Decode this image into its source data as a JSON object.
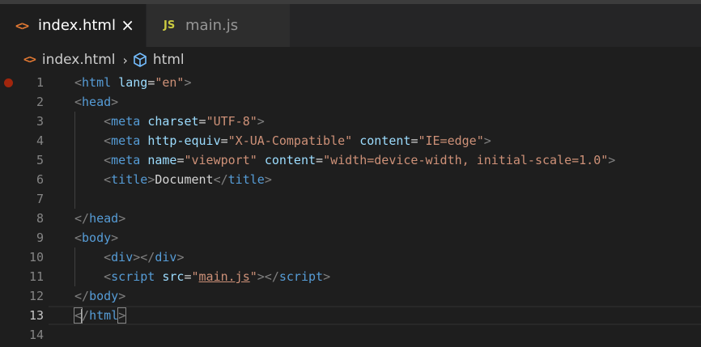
{
  "tabs": [
    {
      "label": "index.html",
      "icon": "html-file-icon",
      "active": true
    },
    {
      "label": "main.js",
      "icon": "js-file-icon",
      "active": false
    }
  ],
  "tab_close": "×",
  "html_glyph": "<>",
  "js_glyph": "JS",
  "breadcrumb": {
    "file": "index.html",
    "symbol": "html",
    "separator": "›"
  },
  "editor": {
    "current_line": 13,
    "lines": [
      {
        "n": "1",
        "tokens": [
          [
            "punc",
            "<"
          ],
          [
            "tag",
            "html"
          ],
          [
            "text",
            " "
          ],
          [
            "attr",
            "lang"
          ],
          [
            "eq",
            "="
          ],
          [
            "str",
            "\"en\""
          ],
          [
            "punc",
            ">"
          ]
        ]
      },
      {
        "n": "2",
        "tokens": [
          [
            "punc",
            "<"
          ],
          [
            "tag",
            "head"
          ],
          [
            "punc",
            ">"
          ]
        ]
      },
      {
        "n": "3",
        "tokens": [
          [
            "text",
            "    "
          ],
          [
            "punc",
            "<"
          ],
          [
            "tag",
            "meta"
          ],
          [
            "text",
            " "
          ],
          [
            "attr",
            "charset"
          ],
          [
            "eq",
            "="
          ],
          [
            "str",
            "\"UTF-8\""
          ],
          [
            "punc",
            ">"
          ]
        ]
      },
      {
        "n": "4",
        "tokens": [
          [
            "text",
            "    "
          ],
          [
            "punc",
            "<"
          ],
          [
            "tag",
            "meta"
          ],
          [
            "text",
            " "
          ],
          [
            "attr",
            "http-equiv"
          ],
          [
            "eq",
            "="
          ],
          [
            "str",
            "\"X-UA-Compatible\""
          ],
          [
            "text",
            " "
          ],
          [
            "attr",
            "content"
          ],
          [
            "eq",
            "="
          ],
          [
            "str",
            "\"IE=edge\""
          ],
          [
            "punc",
            ">"
          ]
        ]
      },
      {
        "n": "5",
        "tokens": [
          [
            "text",
            "    "
          ],
          [
            "punc",
            "<"
          ],
          [
            "tag",
            "meta"
          ],
          [
            "text",
            " "
          ],
          [
            "attr",
            "name"
          ],
          [
            "eq",
            "="
          ],
          [
            "str",
            "\"viewport\""
          ],
          [
            "text",
            " "
          ],
          [
            "attr",
            "content"
          ],
          [
            "eq",
            "="
          ],
          [
            "str",
            "\"width=device-width, initial-scale=1.0\""
          ],
          [
            "punc",
            ">"
          ]
        ]
      },
      {
        "n": "6",
        "tokens": [
          [
            "text",
            "    "
          ],
          [
            "punc",
            "<"
          ],
          [
            "tag",
            "title"
          ],
          [
            "punc",
            ">"
          ],
          [
            "text",
            "Document"
          ],
          [
            "punc",
            "</"
          ],
          [
            "tag",
            "title"
          ],
          [
            "punc",
            ">"
          ]
        ]
      },
      {
        "n": "7",
        "tokens": []
      },
      {
        "n": "8",
        "tokens": [
          [
            "punc",
            "</"
          ],
          [
            "tag",
            "head"
          ],
          [
            "punc",
            ">"
          ]
        ]
      },
      {
        "n": "9",
        "tokens": [
          [
            "punc",
            "<"
          ],
          [
            "tag",
            "body"
          ],
          [
            "punc",
            ">"
          ]
        ]
      },
      {
        "n": "10",
        "tokens": [
          [
            "text",
            "    "
          ],
          [
            "punc",
            "<"
          ],
          [
            "tag",
            "div"
          ],
          [
            "punc",
            "></"
          ],
          [
            "tag",
            "div"
          ],
          [
            "punc",
            ">"
          ]
        ]
      },
      {
        "n": "11",
        "tokens": [
          [
            "text",
            "    "
          ],
          [
            "punc",
            "<"
          ],
          [
            "tag",
            "script"
          ],
          [
            "text",
            " "
          ],
          [
            "attr",
            "src"
          ],
          [
            "eq",
            "="
          ],
          [
            "str",
            "\""
          ],
          [
            "link",
            "main.js"
          ],
          [
            "str",
            "\""
          ],
          [
            "punc",
            "></"
          ],
          [
            "tag",
            "script"
          ],
          [
            "punc",
            ">"
          ]
        ]
      },
      {
        "n": "12",
        "tokens": [
          [
            "punc",
            "</"
          ],
          [
            "tag",
            "body"
          ],
          [
            "punc",
            ">"
          ]
        ]
      },
      {
        "n": "13",
        "tokens": [
          [
            "bracket",
            "<"
          ],
          [
            "cursor",
            ""
          ],
          [
            "punc",
            "/"
          ],
          [
            "tag",
            "html"
          ],
          [
            "bracket",
            ">"
          ]
        ]
      },
      {
        "n": "14",
        "tokens": []
      }
    ]
  },
  "colors": {
    "editor_bg": "#1e1e1e",
    "tag": "#569cd6",
    "attr": "#9cdcfe",
    "string": "#ce9178",
    "punctuation": "#808080",
    "breakpoint": "#a1260d"
  }
}
